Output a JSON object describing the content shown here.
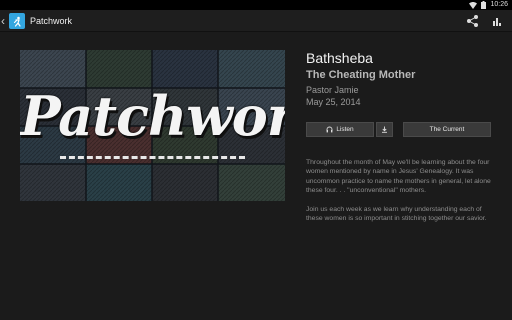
{
  "status_bar": {
    "time": "10:26",
    "icons": [
      "wifi-icon",
      "battery-icon"
    ]
  },
  "action_bar": {
    "title": "Patchwork",
    "icons": [
      "chevron-left-icon",
      "app-logo-icon",
      "share-icon",
      "bar-chart-icon"
    ]
  },
  "artwork": {
    "title": "Patchwork"
  },
  "sermon": {
    "title": "Bathsheba",
    "subtitle": "The Cheating Mother",
    "speaker": "Pastor Jamie",
    "date": "May 25, 2014"
  },
  "buttons": {
    "listen_label": "Listen",
    "series_label": "The Current"
  },
  "description": {
    "paragraph1": "Throughout the month of May we'll be learning about the four women mentioned by name in Jesus' Genealogy. It was uncommon practice to name the mothers in general, let alone these four. . . \"unconventional\" mothers.",
    "paragraph2": "Join us each week as we learn why understanding each of these women is so important in stitching together our savior."
  },
  "colors": {
    "background": "#1b1b1b",
    "accent": "#33a6e0",
    "button": "#3a3a3a"
  }
}
